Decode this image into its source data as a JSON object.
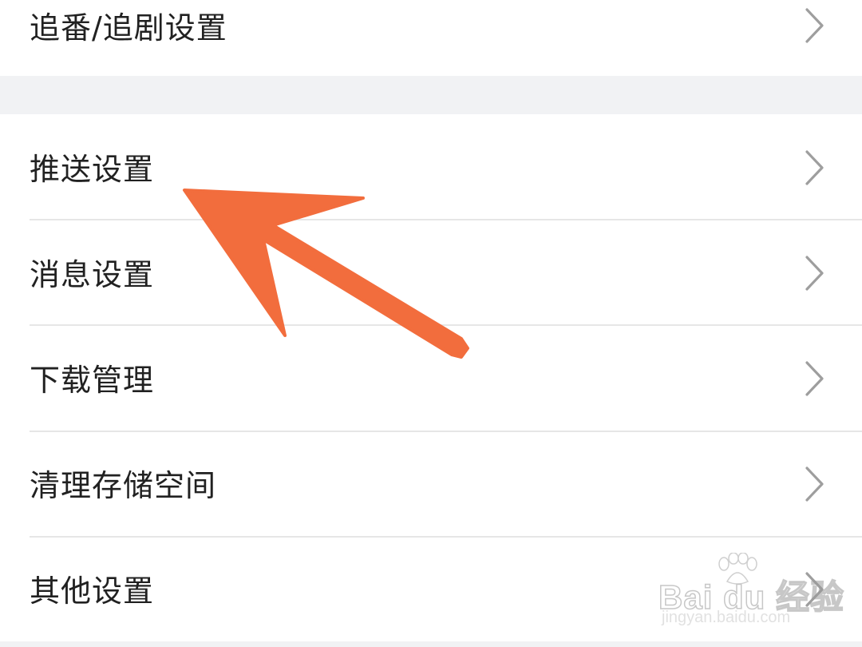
{
  "settings": {
    "top_item": {
      "label": "追番/追剧设置"
    },
    "items": [
      {
        "label": "推送设置"
      },
      {
        "label": "消息设置"
      },
      {
        "label": "下载管理"
      },
      {
        "label": "清理存储空间"
      },
      {
        "label": "其他设置"
      }
    ]
  },
  "icons": {
    "row_chevron": "chevron-right-icon",
    "annotation": "arrow-annotation",
    "watermark_logo": "baidu-paw-icon"
  },
  "watermark": {
    "logo_text": "Bai du 经验",
    "url": "jingyan.baidu.com"
  },
  "colors": {
    "background": "#f1f2f4",
    "row_background": "#ffffff",
    "label_text": "#212121",
    "chevron": "#9e9e9e",
    "divider": "#e6e6e6",
    "annotation_arrow": "#f26d3d"
  }
}
